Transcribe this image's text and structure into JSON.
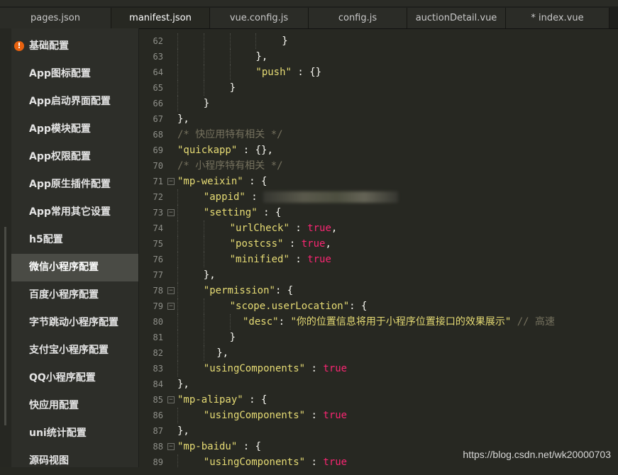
{
  "tabs": [
    {
      "label": "pages.json"
    },
    {
      "label": "manifest.json"
    },
    {
      "label": "vue.config.js"
    },
    {
      "label": "config.js"
    },
    {
      "label": "auctionDetail.vue"
    },
    {
      "label": "* index.vue"
    }
  ],
  "active_tab": "manifest.json",
  "sidebar": {
    "items": [
      {
        "label": "基础配置",
        "warning": true
      },
      {
        "label": "App图标配置"
      },
      {
        "label": "App启动界面配置"
      },
      {
        "label": "App模块配置"
      },
      {
        "label": "App权限配置"
      },
      {
        "label": "App原生插件配置"
      },
      {
        "label": "App常用其它设置"
      },
      {
        "label": "h5配置"
      },
      {
        "label": "微信小程序配置",
        "active": true
      },
      {
        "label": "百度小程序配置"
      },
      {
        "label": "字节跳动小程序配置"
      },
      {
        "label": "支付宝小程序配置"
      },
      {
        "label": "QQ小程序配置"
      },
      {
        "label": "快应用配置"
      },
      {
        "label": "uni统计配置"
      },
      {
        "label": "源码视图"
      }
    ],
    "warning_icon": "!"
  },
  "editor": {
    "lines": [
      {
        "n": "62",
        "indent": 16,
        "fold": false,
        "tokens": [
          {
            "t": "}",
            "c": "pun"
          }
        ]
      },
      {
        "n": "63",
        "indent": 12,
        "fold": false,
        "tokens": [
          {
            "t": "},",
            "c": "pun"
          }
        ]
      },
      {
        "n": "64",
        "indent": 12,
        "fold": false,
        "tokens": [
          {
            "t": "\"push\"",
            "c": "str"
          },
          {
            "t": " : {}",
            "c": "pun"
          }
        ]
      },
      {
        "n": "65",
        "indent": 8,
        "fold": false,
        "tokens": [
          {
            "t": "}",
            "c": "pun"
          }
        ]
      },
      {
        "n": "66",
        "indent": 4,
        "fold": false,
        "tokens": [
          {
            "t": "}",
            "c": "pun"
          }
        ]
      },
      {
        "n": "67",
        "indent": 0,
        "fold": false,
        "tokens": [
          {
            "t": "},",
            "c": "pun"
          }
        ]
      },
      {
        "n": "68",
        "indent": 0,
        "fold": false,
        "tokens": [
          {
            "t": "/* 快应用特有相关 */",
            "c": "com"
          }
        ]
      },
      {
        "n": "69",
        "indent": 0,
        "fold": false,
        "tokens": [
          {
            "t": "\"quickapp\"",
            "c": "str"
          },
          {
            "t": " : {},",
            "c": "pun"
          }
        ]
      },
      {
        "n": "70",
        "indent": 0,
        "fold": false,
        "tokens": [
          {
            "t": "/* 小程序特有相关 */",
            "c": "com"
          }
        ]
      },
      {
        "n": "71",
        "indent": 0,
        "fold": true,
        "tokens": [
          {
            "t": "\"mp-weixin\"",
            "c": "str"
          },
          {
            "t": " : {",
            "c": "pun"
          }
        ]
      },
      {
        "n": "72",
        "indent": 4,
        "fold": false,
        "tokens": [
          {
            "t": "\"appid\"",
            "c": "str"
          },
          {
            "t": " : ",
            "c": "pun"
          },
          {
            "t": "",
            "c": "blur"
          }
        ]
      },
      {
        "n": "73",
        "indent": 4,
        "fold": true,
        "tokens": [
          {
            "t": "\"setting\"",
            "c": "str"
          },
          {
            "t": " : {",
            "c": "pun"
          }
        ]
      },
      {
        "n": "74",
        "indent": 8,
        "fold": false,
        "tokens": [
          {
            "t": "\"urlCheck\"",
            "c": "str"
          },
          {
            "t": " : ",
            "c": "pun"
          },
          {
            "t": "true",
            "c": "bool"
          },
          {
            "t": ",",
            "c": "pun"
          }
        ]
      },
      {
        "n": "75",
        "indent": 8,
        "fold": false,
        "tokens": [
          {
            "t": "\"postcss\"",
            "c": "str"
          },
          {
            "t": " : ",
            "c": "pun"
          },
          {
            "t": "true",
            "c": "bool"
          },
          {
            "t": ",",
            "c": "pun"
          }
        ]
      },
      {
        "n": "76",
        "indent": 8,
        "fold": false,
        "tokens": [
          {
            "t": "\"minified\"",
            "c": "str"
          },
          {
            "t": " : ",
            "c": "pun"
          },
          {
            "t": "true",
            "c": "bool"
          }
        ]
      },
      {
        "n": "77",
        "indent": 4,
        "fold": false,
        "tokens": [
          {
            "t": "},",
            "c": "pun"
          }
        ]
      },
      {
        "n": "78",
        "indent": 4,
        "fold": true,
        "tokens": [
          {
            "t": "\"permission\"",
            "c": "str"
          },
          {
            "t": ": {",
            "c": "pun"
          }
        ]
      },
      {
        "n": "79",
        "indent": 8,
        "fold": true,
        "tokens": [
          {
            "t": "\"scope.userLocation\"",
            "c": "str"
          },
          {
            "t": ": {",
            "c": "pun"
          }
        ]
      },
      {
        "n": "80",
        "indent": 10,
        "fold": false,
        "tokens": [
          {
            "t": "\"desc\"",
            "c": "str"
          },
          {
            "t": ": ",
            "c": "pun"
          },
          {
            "t": "\"你的位置信息将用于小程序位置接口的效果展示\"",
            "c": "str"
          },
          {
            "t": " // 高速",
            "c": "com"
          }
        ]
      },
      {
        "n": "81",
        "indent": 8,
        "fold": false,
        "tokens": [
          {
            "t": "}",
            "c": "pun"
          }
        ]
      },
      {
        "n": "82",
        "indent": 6,
        "fold": false,
        "tokens": [
          {
            "t": "},",
            "c": "pun"
          }
        ]
      },
      {
        "n": "83",
        "indent": 4,
        "fold": false,
        "tokens": [
          {
            "t": "\"usingComponents\"",
            "c": "str"
          },
          {
            "t": " : ",
            "c": "pun"
          },
          {
            "t": "true",
            "c": "bool"
          }
        ]
      },
      {
        "n": "84",
        "indent": 0,
        "fold": false,
        "tokens": [
          {
            "t": "},",
            "c": "pun"
          }
        ]
      },
      {
        "n": "85",
        "indent": 0,
        "fold": true,
        "tokens": [
          {
            "t": "\"mp-alipay\"",
            "c": "str"
          },
          {
            "t": " : {",
            "c": "pun"
          }
        ]
      },
      {
        "n": "86",
        "indent": 4,
        "fold": false,
        "tokens": [
          {
            "t": "\"usingComponents\"",
            "c": "str"
          },
          {
            "t": " : ",
            "c": "pun"
          },
          {
            "t": "true",
            "c": "bool"
          }
        ]
      },
      {
        "n": "87",
        "indent": 0,
        "fold": false,
        "tokens": [
          {
            "t": "},",
            "c": "pun"
          }
        ]
      },
      {
        "n": "88",
        "indent": 0,
        "fold": true,
        "tokens": [
          {
            "t": "\"mp-baidu\"",
            "c": "str"
          },
          {
            "t": " : {",
            "c": "pun"
          }
        ]
      },
      {
        "n": "89",
        "indent": 4,
        "fold": false,
        "tokens": [
          {
            "t": "\"usingComponents\"",
            "c": "str"
          },
          {
            "t": " : ",
            "c": "pun"
          },
          {
            "t": "true",
            "c": "bool"
          }
        ]
      }
    ],
    "fold_glyph": "−"
  },
  "watermark": "https://blog.csdn.net/wk20000703",
  "colors": {
    "background": "#272822",
    "sidebar": "#2d2e29",
    "sidebar_active": "#4a4b45",
    "string": "#e6db74",
    "boolean": "#f92672",
    "comment": "#75715e",
    "warning": "#e8620f"
  }
}
